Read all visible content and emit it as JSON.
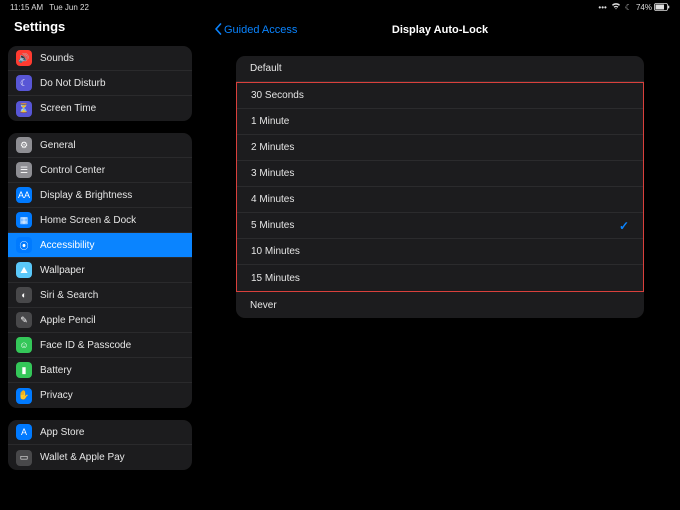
{
  "status": {
    "time": "11:15 AM",
    "date": "Tue Jun 22",
    "battery_pct": "74%"
  },
  "sidebar": {
    "title": "Settings",
    "groups": [
      [
        {
          "icon": "speaker-icon",
          "name": "sidebar-item-sounds",
          "color": "ic-red",
          "label": "Sounds"
        },
        {
          "icon": "moon-icon",
          "name": "sidebar-item-dnd",
          "color": "ic-purple",
          "label": "Do Not Disturb"
        },
        {
          "icon": "hourglass-icon",
          "name": "sidebar-item-screen-time",
          "color": "ic-purple",
          "label": "Screen Time"
        }
      ],
      [
        {
          "icon": "gear-icon",
          "name": "sidebar-item-general",
          "color": "ic-grey",
          "label": "General"
        },
        {
          "icon": "toggles-icon",
          "name": "sidebar-item-control-center",
          "color": "ic-grey",
          "label": "Control Center"
        },
        {
          "icon": "textsize-icon",
          "name": "sidebar-item-display",
          "color": "ic-blue",
          "label": "Display & Brightness"
        },
        {
          "icon": "grid-icon",
          "name": "sidebar-item-home-dock",
          "color": "ic-blue",
          "label": "Home Screen & Dock"
        },
        {
          "icon": "person-icon",
          "name": "sidebar-item-accessibility",
          "color": "ic-blue",
          "label": "Accessibility",
          "selected": true
        },
        {
          "icon": "photo-icon",
          "name": "sidebar-item-wallpaper",
          "color": "ic-teal",
          "label": "Wallpaper"
        },
        {
          "icon": "siri-icon",
          "name": "sidebar-item-siri",
          "color": "ic-dgrey",
          "label": "Siri & Search"
        },
        {
          "icon": "pencil-icon",
          "name": "sidebar-item-apple-pencil",
          "color": "ic-dgrey",
          "label": "Apple Pencil"
        },
        {
          "icon": "faceid-icon",
          "name": "sidebar-item-faceid",
          "color": "ic-green",
          "label": "Face ID & Passcode"
        },
        {
          "icon": "battery-icon",
          "name": "sidebar-item-battery",
          "color": "ic-green",
          "label": "Battery"
        },
        {
          "icon": "hand-icon",
          "name": "sidebar-item-privacy",
          "color": "ic-blue",
          "label": "Privacy"
        }
      ],
      [
        {
          "icon": "appstore-icon",
          "name": "sidebar-item-appstore",
          "color": "ic-blue",
          "label": "App Store"
        },
        {
          "icon": "wallet-icon",
          "name": "sidebar-item-wallet",
          "color": "ic-dgrey",
          "label": "Wallet & Apple Pay"
        }
      ]
    ]
  },
  "detail": {
    "back_label": "Guided Access",
    "title": "Display Auto-Lock",
    "options": [
      {
        "label": "Default",
        "selected": false,
        "highlight": false
      },
      {
        "label": "30 Seconds",
        "selected": false,
        "highlight": true
      },
      {
        "label": "1 Minute",
        "selected": false,
        "highlight": true
      },
      {
        "label": "2 Minutes",
        "selected": false,
        "highlight": true
      },
      {
        "label": "3 Minutes",
        "selected": false,
        "highlight": true
      },
      {
        "label": "4 Minutes",
        "selected": false,
        "highlight": true
      },
      {
        "label": "5 Minutes",
        "selected": true,
        "highlight": true
      },
      {
        "label": "10 Minutes",
        "selected": false,
        "highlight": true
      },
      {
        "label": "15 Minutes",
        "selected": false,
        "highlight": true
      },
      {
        "label": "Never",
        "selected": false,
        "highlight": false
      }
    ]
  },
  "glyphs": {
    "speaker-icon": "🔊",
    "moon-icon": "☾",
    "hourglass-icon": "⏳",
    "gear-icon": "⚙",
    "toggles-icon": "☰",
    "textsize-icon": "AA",
    "grid-icon": "▦",
    "person-icon": "⦿",
    "photo-icon": "⛰",
    "siri-icon": "◐",
    "pencil-icon": "✎",
    "faceid-icon": "☺",
    "battery-icon": "▮",
    "hand-icon": "✋",
    "appstore-icon": "A",
    "wallet-icon": "▭"
  }
}
